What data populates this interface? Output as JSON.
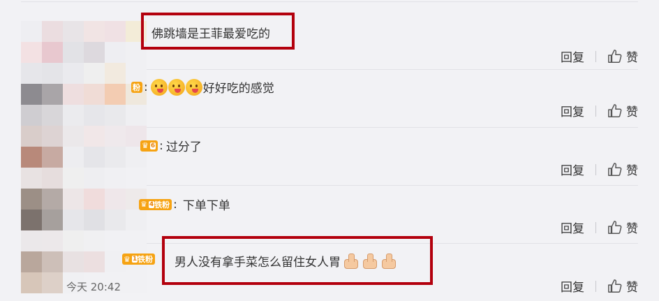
{
  "comments": [
    {
      "text": "佛跳墙是王菲最爱吃的",
      "reply": "回复",
      "like": "赞"
    },
    {
      "badge": "粉",
      "text": "好好吃的感觉",
      "reply": "回复",
      "like": "赞"
    },
    {
      "badge": "6",
      "text": "过分了",
      "reply": "回复",
      "like": "赞"
    },
    {
      "badge": "铁粉",
      "badge_level": "4",
      "text": "下单下单",
      "reply": "回复",
      "like": "赞"
    },
    {
      "badge": "铁粉",
      "badge_level": "1",
      "text": "男人没有拿手菜怎么留住女人胃",
      "time": "今天 20:42",
      "reply": "回复",
      "like": "赞"
    }
  ],
  "icons": {
    "like": "thumbs-up-outline-icon",
    "emoji": "yummy-face-emoji",
    "thumb": "thumbs-up-emoji",
    "crown": "crown-icon"
  },
  "colors": {
    "highlight_box": "#b3000d",
    "badge": "#f6a313",
    "background": "#f2f2f5"
  }
}
